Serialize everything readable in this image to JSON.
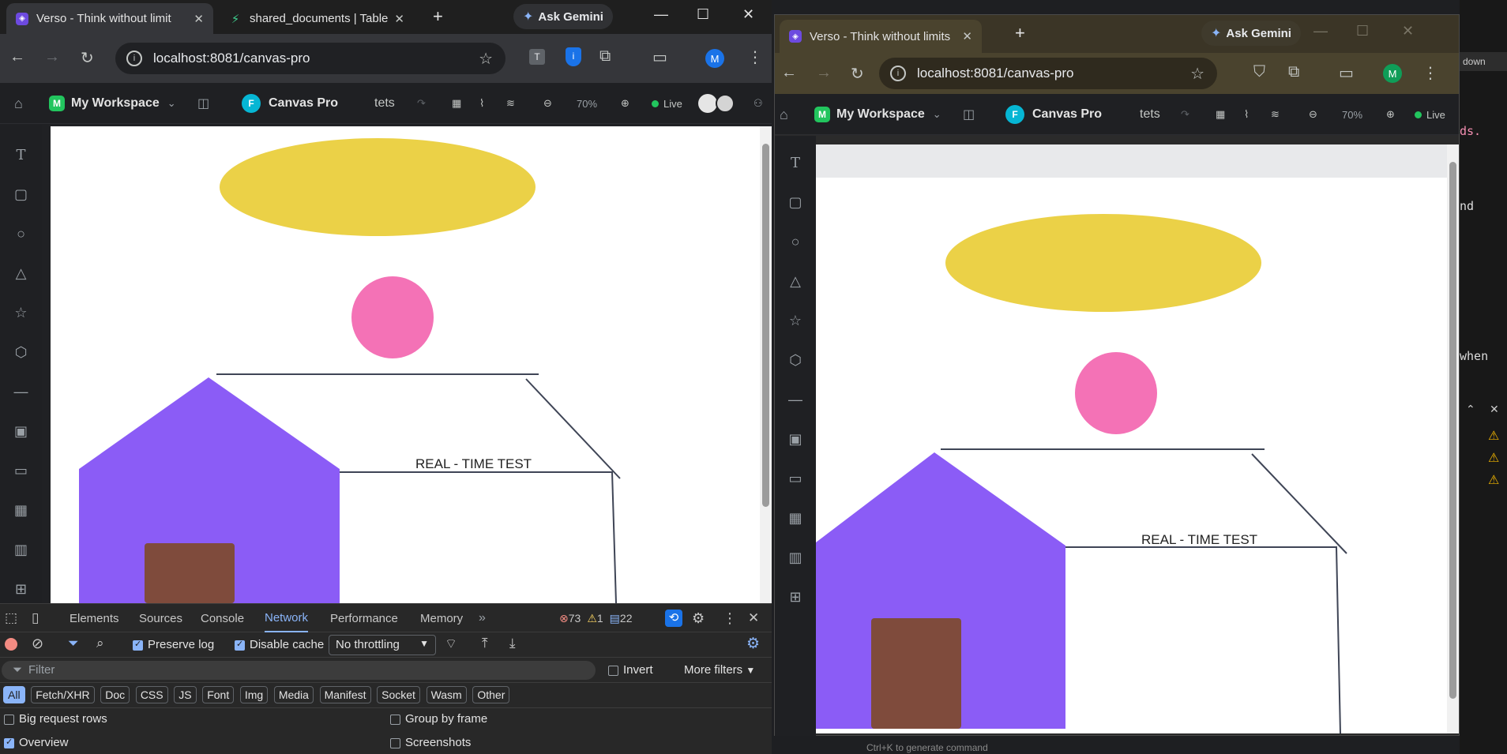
{
  "left_window": {
    "tabs": [
      {
        "title": "Verso - Think without limit",
        "active": true
      },
      {
        "title": "shared_documents | Table",
        "active": false
      }
    ],
    "new_tab": "+",
    "gemini": "Ask Gemini",
    "url": "localhost:8081/canvas-pro",
    "profile": "M",
    "ext_t": "T"
  },
  "right_window": {
    "tabs": [
      {
        "title": "Verso - Think without limits",
        "active": true
      }
    ],
    "new_tab": "+",
    "gemini": "Ask Gemini",
    "url": "localhost:8081/canvas-pro",
    "profile": "M"
  },
  "app": {
    "workspace_badge": "M",
    "workspace": "My Workspace",
    "project_badge": "F",
    "project": "Canvas Pro",
    "doc_name": "tets",
    "zoom": "70%",
    "live": "Live",
    "canvas_text": "REAL - TIME TEST",
    "colors": {
      "ellipse": "#ebd147",
      "circle": "#f472b6",
      "house": "#8b5cf6",
      "door": "#7f4b3c",
      "line": "#3f4556"
    }
  },
  "tool_rail_icons": [
    "home-icon",
    "text-tool-icon",
    "rectangle-tool-icon",
    "circle-tool-icon",
    "triangle-tool-icon",
    "star-tool-icon",
    "hexagon-tool-icon",
    "line-tool-icon",
    "image-tool-icon",
    "video-tool-icon",
    "qr-tool-icon",
    "chart-tool-icon",
    "table-tool-icon"
  ],
  "devtools": {
    "tabs": [
      "Elements",
      "Sources",
      "Console",
      "Network",
      "Performance",
      "Memory"
    ],
    "active_tab": "Network",
    "errors": "73",
    "warnings": "1",
    "messages": "22",
    "preserve_log": "Preserve log",
    "disable_cache": "Disable cache",
    "throttling": "No throttling",
    "filter_placeholder": "Filter",
    "invert": "Invert",
    "more_filters": "More filters",
    "type_filters": [
      "All",
      "Fetch/XHR",
      "Doc",
      "CSS",
      "JS",
      "Font",
      "Img",
      "Media",
      "Manifest",
      "Socket",
      "Wasm",
      "Other"
    ],
    "big_request_rows": "Big request rows",
    "group_by_frame": "Group by frame",
    "overview": "Overview",
    "screenshots": "Screenshots"
  },
  "editor_bg": {
    "down": "down",
    "code1": "ds.",
    "code2": "nd",
    "code3": "when",
    "hint": "Ctrl+K to generate command"
  }
}
